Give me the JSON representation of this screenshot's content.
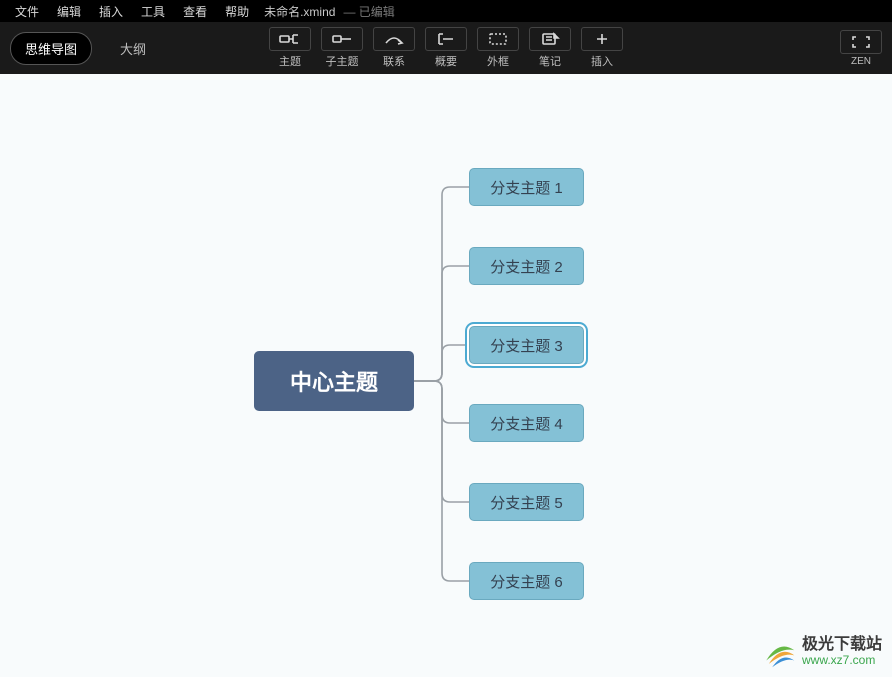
{
  "menubar": {
    "items": [
      "文件",
      "编辑",
      "插入",
      "工具",
      "查看",
      "帮助"
    ],
    "filename": "未命名.xmind",
    "status": "— 已编辑"
  },
  "view_modes": {
    "mindmap": "思维导图",
    "outline": "大纲"
  },
  "toolbar": {
    "topic": "主题",
    "subtopic": "子主题",
    "relationship": "联系",
    "summary": "概要",
    "boundary": "外框",
    "note": "笔记",
    "insert": "插入",
    "zen": "ZEN"
  },
  "mindmap": {
    "central": "中心主题",
    "branches": [
      {
        "label": "分支主题 1"
      },
      {
        "label": "分支主题 2"
      },
      {
        "label": "分支主题 3",
        "selected": true
      },
      {
        "label": "分支主题 4"
      },
      {
        "label": "分支主题 5"
      },
      {
        "label": "分支主题 6"
      }
    ]
  },
  "watermark": {
    "title": "极光下载站",
    "url": "www.xz7.com"
  }
}
